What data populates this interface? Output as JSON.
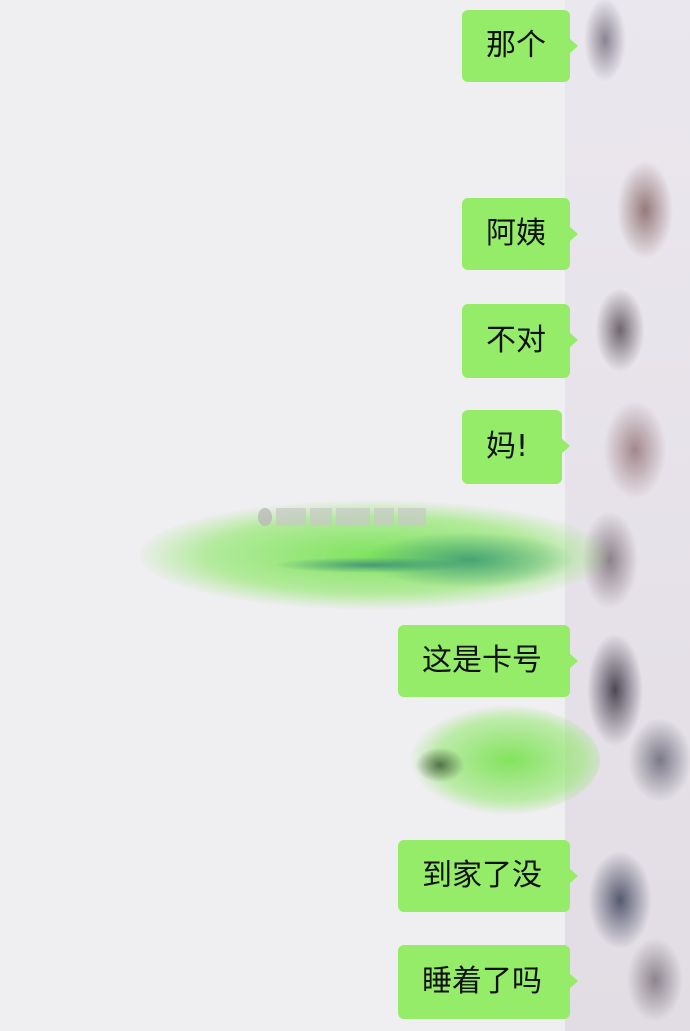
{
  "messages": [
    {
      "text": "那个",
      "sender": "self"
    },
    {
      "text": "阿姨",
      "sender": "self"
    },
    {
      "text": "不对",
      "sender": "self"
    },
    {
      "text": "妈!",
      "sender": "self"
    },
    {
      "text": "这是卡号",
      "sender": "self"
    },
    {
      "text": "到家了没",
      "sender": "self"
    },
    {
      "text": "睡着了吗",
      "sender": "self"
    }
  ],
  "colors": {
    "background": "#efeef1",
    "bubble": "#95ec69",
    "text": "#111111"
  }
}
